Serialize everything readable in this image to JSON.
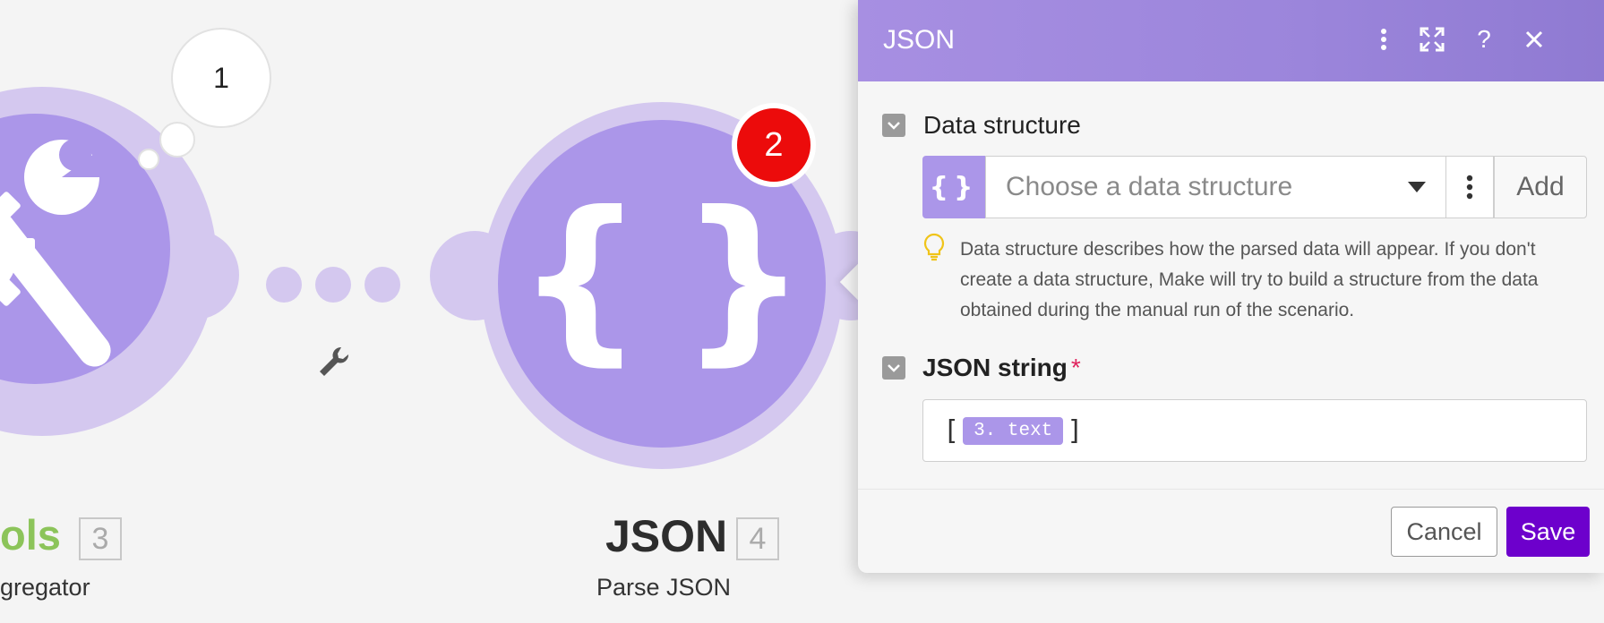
{
  "canvas": {
    "modules": [
      {
        "name": "ols",
        "number": "3",
        "subtitle": "gregator"
      },
      {
        "name": "JSON",
        "number": "4",
        "subtitle": "Parse JSON"
      }
    ],
    "thought_bubble": "1",
    "error_badge": "2",
    "link_icon": "wrench-icon",
    "module_icons": [
      "tools-icon",
      "braces-icon"
    ],
    "colors": {
      "module": "#ab96e9",
      "halo": "#d4c8ef",
      "badge": "#ec0b0b",
      "tools_green": "#8cc45a"
    }
  },
  "panel": {
    "title": "JSON",
    "header_icons": [
      "more-vertical-icon",
      "expand-icon",
      "help-icon",
      "close-icon"
    ],
    "fields": {
      "data_structure": {
        "label": "Data structure",
        "placeholder": "Choose a data structure",
        "add_label": "Add",
        "hint": "Data structure describes how the parsed data will appear. If you don't create a data structure, Make will try to build a structure from the data obtained during the manual run of the scenario."
      },
      "json_string": {
        "label": "JSON string",
        "required_mark": "*",
        "open_bracket": "[",
        "pill": "3. text",
        "close_bracket": "]"
      }
    },
    "buttons": {
      "cancel": "Cancel",
      "save": "Save"
    },
    "colors": {
      "header": "#a78fe2",
      "save": "#6d00cc"
    }
  }
}
